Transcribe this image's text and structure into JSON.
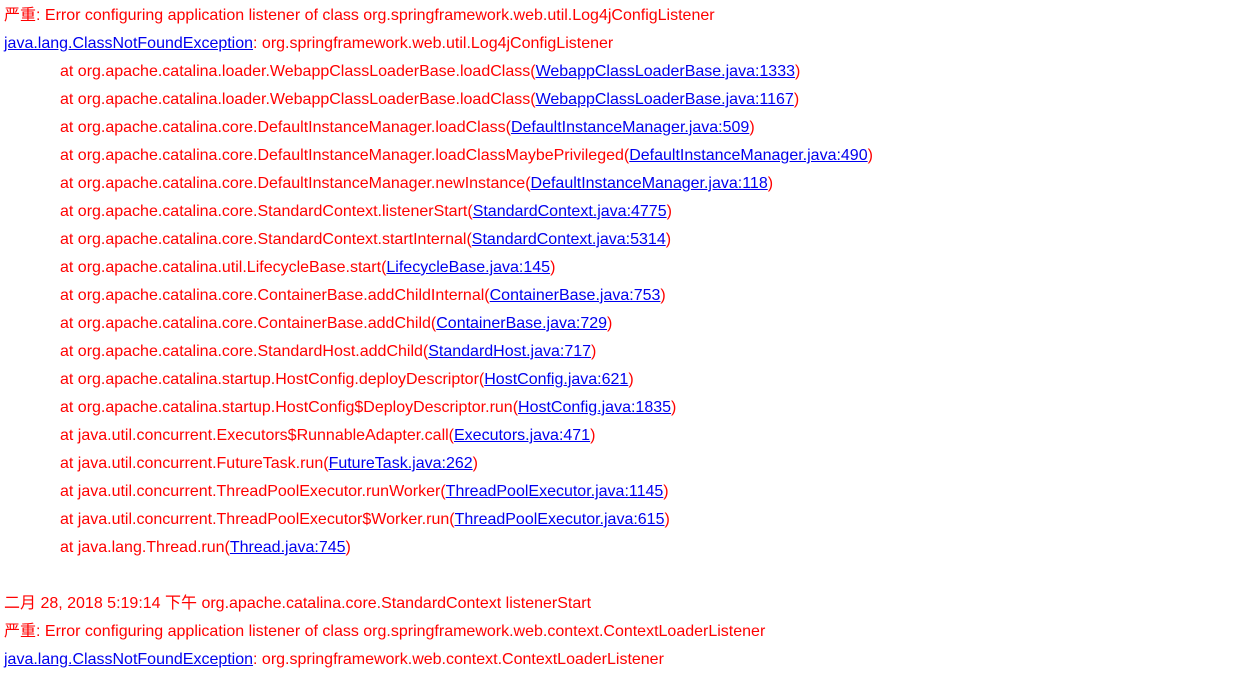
{
  "error1": {
    "severity": "严重",
    "message": ": Error configuring application listener of class org.springframework.web.util.Log4jConfigListener",
    "exception": "java.lang.ClassNotFoundException",
    "exceptionMsg": ": org.springframework.web.util.Log4jConfigListener"
  },
  "stack": [
    {
      "prefix": "at org.apache.catalina.loader.WebappClassLoaderBase.loadClass(",
      "link": "WebappClassLoaderBase.java:1333",
      "suffix": ")"
    },
    {
      "prefix": "at org.apache.catalina.loader.WebappClassLoaderBase.loadClass(",
      "link": "WebappClassLoaderBase.java:1167",
      "suffix": ")"
    },
    {
      "prefix": "at org.apache.catalina.core.DefaultInstanceManager.loadClass(",
      "link": "DefaultInstanceManager.java:509",
      "suffix": ")"
    },
    {
      "prefix": "at org.apache.catalina.core.DefaultInstanceManager.loadClassMaybePrivileged(",
      "link": "DefaultInstanceManager.java:490",
      "suffix": ")"
    },
    {
      "prefix": "at org.apache.catalina.core.DefaultInstanceManager.newInstance(",
      "link": "DefaultInstanceManager.java:118",
      "suffix": ")"
    },
    {
      "prefix": "at org.apache.catalina.core.StandardContext.listenerStart(",
      "link": "StandardContext.java:4775",
      "suffix": ")"
    },
    {
      "prefix": "at org.apache.catalina.core.StandardContext.startInternal(",
      "link": "StandardContext.java:5314",
      "suffix": ")"
    },
    {
      "prefix": "at org.apache.catalina.util.LifecycleBase.start(",
      "link": "LifecycleBase.java:145",
      "suffix": ")"
    },
    {
      "prefix": "at org.apache.catalina.core.ContainerBase.addChildInternal(",
      "link": "ContainerBase.java:753",
      "suffix": ")"
    },
    {
      "prefix": "at org.apache.catalina.core.ContainerBase.addChild(",
      "link": "ContainerBase.java:729",
      "suffix": ")"
    },
    {
      "prefix": "at org.apache.catalina.core.StandardHost.addChild(",
      "link": "StandardHost.java:717",
      "suffix": ")"
    },
    {
      "prefix": "at org.apache.catalina.startup.HostConfig.deployDescriptor(",
      "link": "HostConfig.java:621",
      "suffix": ")"
    },
    {
      "prefix": "at org.apache.catalina.startup.HostConfig$DeployDescriptor.run(",
      "link": "HostConfig.java:1835",
      "suffix": ")"
    },
    {
      "prefix": "at java.util.concurrent.Executors$RunnableAdapter.call(",
      "link": "Executors.java:471",
      "suffix": ")"
    },
    {
      "prefix": "at java.util.concurrent.FutureTask.run(",
      "link": "FutureTask.java:262",
      "suffix": ")"
    },
    {
      "prefix": "at java.util.concurrent.ThreadPoolExecutor.runWorker(",
      "link": "ThreadPoolExecutor.java:1145",
      "suffix": ")"
    },
    {
      "prefix": "at java.util.concurrent.ThreadPoolExecutor$Worker.run(",
      "link": "ThreadPoolExecutor.java:615",
      "suffix": ")"
    },
    {
      "prefix": "at java.lang.Thread.run(",
      "link": "Thread.java:745",
      "suffix": ")"
    }
  ],
  "error2": {
    "timestamp": "二月 28, 2018 5:19:14 下午 org.apache.catalina.core.StandardContext listenerStart",
    "severity": "严重",
    "message": ": Error configuring application listener of class org.springframework.web.context.ContextLoaderListener",
    "exception": "java.lang.ClassNotFoundException",
    "exceptionMsg": ": org.springframework.web.context.ContextLoaderListener"
  }
}
